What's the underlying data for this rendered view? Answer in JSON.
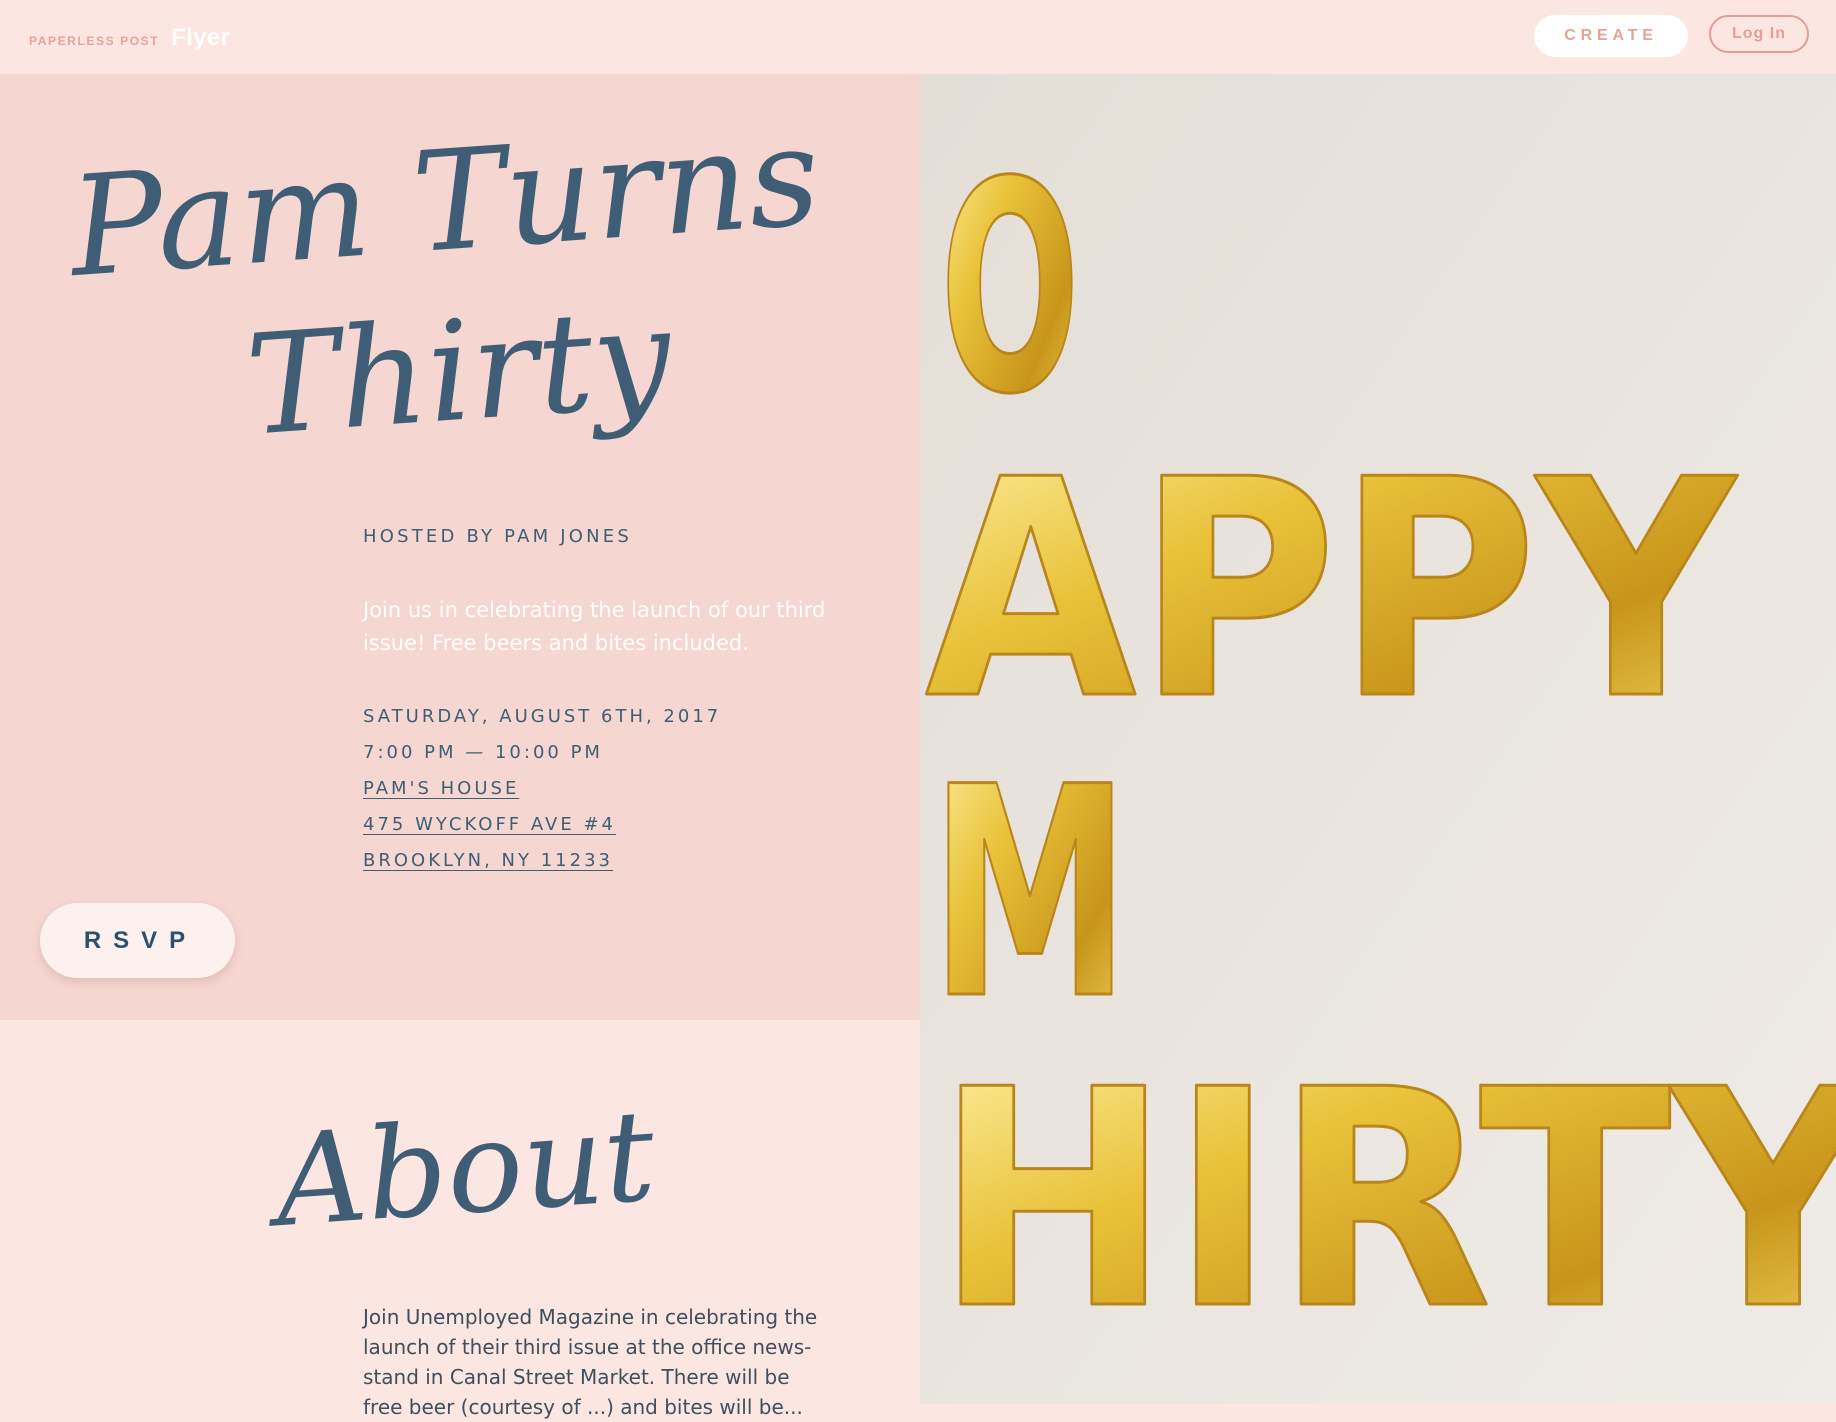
{
  "header": {
    "brand_small": "PAPERLESS POST",
    "brand_product": "Flyer",
    "create_label": "CREATE",
    "login_label": "Log In"
  },
  "invite": {
    "title_line1": "Pam Turns",
    "title_line2": "Thirty",
    "hosted_by": "HOSTED BY PAM JONES",
    "blurb": "Join us in celebrating the launch of our third issue! Free beers and bites included.",
    "date": "SATURDAY, AUGUST 6TH, 2017",
    "time": "7:00 PM — 10:00 PM",
    "venue": "PAM'S HOUSE",
    "address_line1": "475 WYCKOFF AVE #4",
    "address_line2": "BROOKLYN, NY 11233",
    "rsvp_label": "RSVP"
  },
  "about": {
    "title": "About",
    "body": "Join Unemployed Magazine in celebrating the launch of their third issue at the office news-stand in Canal Street Market. There will be free beer (courtesy of ...) and bites will be..."
  },
  "photo": {
    "balloon_rows": [
      "O",
      "APPY",
      "M",
      "HIRTY"
    ]
  },
  "colors": {
    "panel_pink": "#f6d6d1",
    "page_bg": "#fbe6e2",
    "ink_blue": "#3f5e76",
    "accent_coral": "#e7a39a",
    "balloon_gold": "#e5bd2c",
    "photo_wall": "#e9e3dc"
  }
}
